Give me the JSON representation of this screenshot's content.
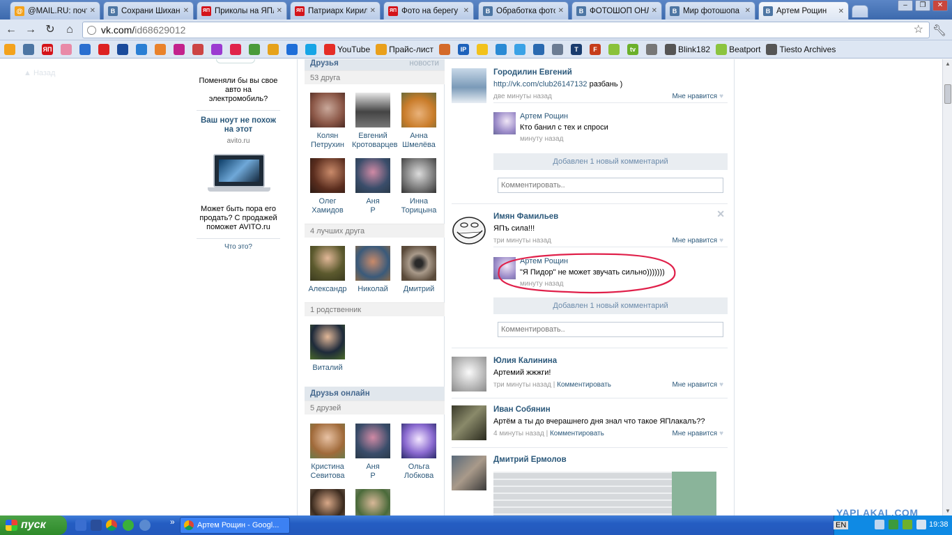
{
  "browser": {
    "tabs": [
      {
        "title": "@MAIL.RU: почта",
        "fav": "@",
        "color": "#f3a21c"
      },
      {
        "title": "Сохрани Шихан",
        "fav": "B",
        "color": "#4c75a3"
      },
      {
        "title": "Приколы на ЯПл",
        "fav": "ЯП",
        "color": "#d4141a"
      },
      {
        "title": "Патриарх Кирил",
        "fav": "ЯП",
        "color": "#d4141a"
      },
      {
        "title": "Фото на берегу",
        "fav": "ЯП",
        "color": "#d4141a"
      },
      {
        "title": "Обработка фото",
        "fav": "B",
        "color": "#4c75a3"
      },
      {
        "title": "ФОТОШОП ОНЛА",
        "fav": "B",
        "color": "#4c75a3"
      },
      {
        "title": "Мир фотошопа",
        "fav": "B",
        "color": "#4c75a3"
      },
      {
        "title": "Артем Рощин",
        "fav": "B",
        "color": "#4c75a3"
      }
    ],
    "url_host": "vk.com/",
    "url_path": "id68629012",
    "bookmarks": [
      {
        "label": "",
        "icon": "mail-icon",
        "color": "#f3a21c"
      },
      {
        "label": "",
        "icon": "chat-icon",
        "color": "#4c75a3"
      },
      {
        "label": "",
        "icon": "yaplakal-icon",
        "color": "#d4141a",
        "text": "ЯП"
      },
      {
        "label": "",
        "icon": "pig-icon",
        "color": "#e98aa8"
      },
      {
        "label": "",
        "icon": "calendar-icon",
        "color": "#2a6fd0"
      },
      {
        "label": "",
        "icon": "x-icon",
        "color": "#d22"
      },
      {
        "label": "",
        "icon": "zv-icon",
        "color": "#1a4b9c"
      },
      {
        "label": "",
        "icon": "kino-icon",
        "color": "#2a7fd4"
      },
      {
        "label": "",
        "icon": "ru-icon",
        "color": "#e9822b"
      },
      {
        "label": "",
        "icon": "slashes-icon",
        "color": "#c3228c"
      },
      {
        "label": "",
        "icon": "plane-icon",
        "color": "#c44"
      },
      {
        "label": "",
        "icon": "power-icon",
        "color": "#9b3ad1"
      },
      {
        "label": "",
        "icon": "ivi-icon",
        "color": "#e0234a"
      },
      {
        "label": "",
        "icon": "map-icon",
        "color": "#4a9b3a"
      },
      {
        "label": "",
        "icon": "rainbow-icon",
        "color": "#e6a21b"
      },
      {
        "label": "",
        "icon": "ie-icon",
        "color": "#1e6ed8"
      },
      {
        "label": "",
        "icon": "skype-icon",
        "color": "#17a5e6"
      },
      {
        "label": "YouTube",
        "icon": "youtube-icon",
        "color": "#e52d27"
      },
      {
        "label": "Прайс-лист",
        "icon": "price-icon",
        "color": "#e9a01c"
      },
      {
        "label": "",
        "icon": "tools-icon",
        "color": "#d46a2a"
      },
      {
        "label": "",
        "icon": "ip-icon",
        "color": "#1d62bb",
        "text": "IP"
      },
      {
        "label": "",
        "icon": "star-icon",
        "color": "#f2c21c"
      },
      {
        "label": "",
        "icon": "drop-icon",
        "color": "#2a8ad4"
      },
      {
        "label": "",
        "icon": "weather-icon",
        "color": "#3aa2e6"
      },
      {
        "label": "",
        "icon": "globe-icon",
        "color": "#2a6ab0"
      },
      {
        "label": "",
        "icon": "doc-icon",
        "color": "#6b7c93"
      },
      {
        "label": "",
        "icon": "t-icon",
        "color": "#1a3c6e",
        "text": "T"
      },
      {
        "label": "",
        "icon": "f-icon",
        "color": "#c63d1b",
        "text": "F"
      },
      {
        "label": "",
        "icon": "circle-icon",
        "color": "#8ac23a"
      },
      {
        "label": "",
        "icon": "tv-icon",
        "color": "#6bb02a",
        "text": "tv"
      },
      {
        "label": "",
        "icon": "dvb-icon",
        "color": "#777"
      },
      {
        "label": "Blink182",
        "icon": "blink-icon",
        "color": "#555"
      },
      {
        "label": "Beatport",
        "icon": "beatport-icon",
        "color": "#8bc43f"
      },
      {
        "label": "Tiesto Archives",
        "icon": "tiesto-icon",
        "color": "#555"
      }
    ]
  },
  "ads": {
    "ghost_link": "Назад",
    "ad1_text": "Поменяли бы вы свое авто на электромобиль?",
    "ad2_title": "Ваш ноут не похож на этот",
    "ad2_domain": "avito.ru",
    "ad2_text": "Может быть пора его продать? С продажей поможет AVITO.ru",
    "what_is": "Что это?"
  },
  "friends": {
    "header": "Друзья",
    "header_link": "новости",
    "count": "53 друга",
    "list": [
      {
        "first": "Колян",
        "last": "Петрухин"
      },
      {
        "first": "Евгений",
        "last": "Кротоварцев"
      },
      {
        "first": "Анна",
        "last": "Шмелёва"
      },
      {
        "first": "Олег",
        "last": "Хамидов"
      },
      {
        "first": "Аня",
        "last": "Р"
      },
      {
        "first": "Инна",
        "last": "Торицына"
      }
    ],
    "best_count": "4 лучших друга",
    "best": [
      {
        "first": "Александр"
      },
      {
        "first": "Николай"
      },
      {
        "first": "Дмитрий"
      }
    ],
    "relatives_count": "1 родственник",
    "relatives": [
      {
        "first": "Виталий"
      }
    ],
    "online_header": "Друзья онлайн",
    "online_count": "5 друзей",
    "online": [
      {
        "first": "Кристина",
        "last": "Севитова"
      },
      {
        "first": "Аня",
        "last": "Р"
      },
      {
        "first": "Ольга",
        "last": "Лобкова"
      }
    ]
  },
  "feed": {
    "posts": [
      {
        "author": "Городилин Евгений",
        "text_link": "http://vk.com/club26147132",
        "text": " разбань )",
        "time": "две минуты назад",
        "like": "Мне нравится",
        "comment": {
          "author": "Артем Рощин",
          "text": "Кто банил с тех и спроси",
          "time": "минуту назад"
        },
        "added": "Добавлен 1 новый комментарий",
        "placeholder": "Комментировать.."
      },
      {
        "author": "Имян Фамильев",
        "text": "ЯПъ сила!!!",
        "time": "три минуты назад",
        "like": "Мне нравится",
        "comment": {
          "author": "Артем Рощин",
          "text": "\"Я Пидор\" не может звучать сильно)))))))",
          "time": "минуту назад"
        },
        "added": "Добавлен 1 новый комментарий",
        "placeholder": "Комментировать.."
      },
      {
        "author": "Юлия Калинина",
        "text": "Артемий жжжги!",
        "time": "три минуты назад",
        "comment_link": "Комментировать",
        "like": "Мне нравится"
      },
      {
        "author": "Иван Собянин",
        "text": "Артём а ты до вчерашнего дня знал что такое ЯПлакалъ??",
        "time": "4 минуты назад",
        "comment_link": "Комментировать",
        "like": "Мне нравится"
      },
      {
        "author": "Дмитрий Ермолов"
      }
    ]
  },
  "taskbar": {
    "start": "пуск",
    "window": "Артем Рощин - Googl...",
    "lang": "EN",
    "clock": "19:38"
  },
  "watermark": "YAPLAKAL.COM"
}
